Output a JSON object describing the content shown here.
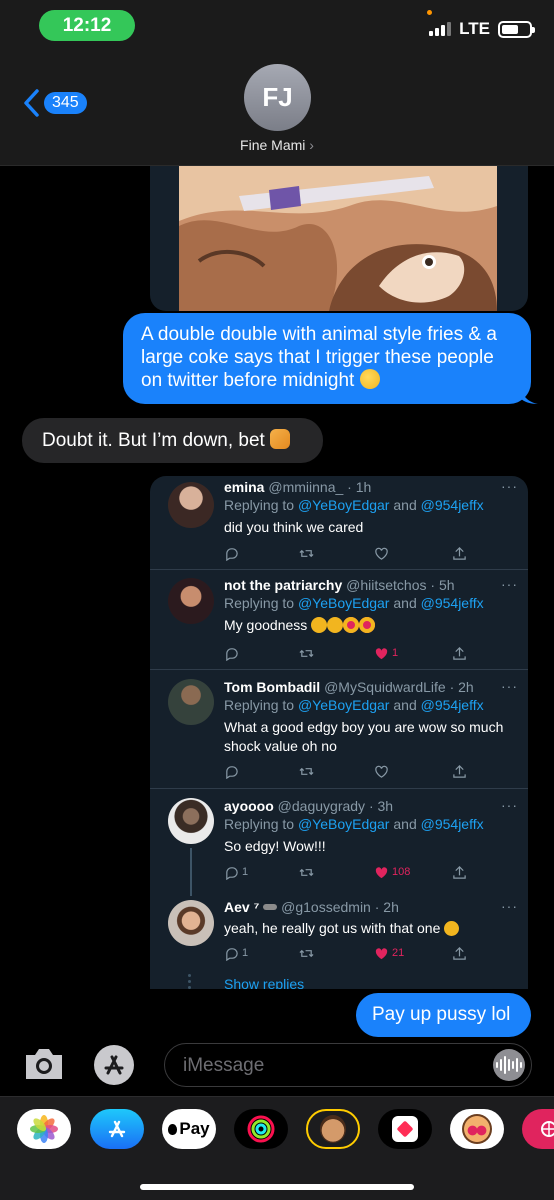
{
  "status_bar": {
    "time": "12:12",
    "network": "LTE",
    "battery_level": 0.6
  },
  "header": {
    "back_count": "345",
    "avatar_initials": "FJ",
    "contact_name": "Fine Mami",
    "chevron": "›"
  },
  "messages": {
    "out_1": "A double double with animal style fries & a large coke says that I trigger these people on twitter before midnight",
    "in_1": "Doubt it. But I’m down, bet",
    "out_2": "Pay up pussy lol"
  },
  "tweets": [
    {
      "name": "emina",
      "handle": "@mmiinna_ · 1h",
      "reply_prefix": "Replying to ",
      "mention_1": "@YeBoyEdgar",
      "reply_and": " and ",
      "mention_2": "@954jeffx",
      "text": "did you think we cared",
      "replies": "",
      "likes": "",
      "liked": false
    },
    {
      "name": "not the patriarchy",
      "handle": "@hiitsetchos · 5h",
      "reply_prefix": "Replying to ",
      "mention_1": "@YeBoyEdgar",
      "reply_and": " and ",
      "mention_2": "@954jeffx",
      "text": "My goodness",
      "replies": "",
      "likes": "1",
      "liked": true
    },
    {
      "name": "Tom Bombadil",
      "handle": "@MySquidwardLife · 2h",
      "reply_prefix": "Replying to ",
      "mention_1": "@YeBoyEdgar",
      "reply_and": " and ",
      "mention_2": "@954jeffx",
      "text": "What a good edgy boy you are wow so much shock value oh no",
      "replies": "",
      "likes": "",
      "liked": false
    },
    {
      "name": "ayoooo",
      "handle": "@daguygrady · 3h",
      "reply_prefix": "Replying to ",
      "mention_1": "@YeBoyEdgar",
      "reply_and": " and ",
      "mention_2": "@954jeffx",
      "text": "So edgy! Wow!!!",
      "replies": "1",
      "likes": "108",
      "liked": true
    },
    {
      "name": "Aev ⁷",
      "handle": "@g1ossedmin · 2h",
      "text": "yeah, he really got us with that one",
      "replies": "1",
      "likes": "21",
      "liked": true
    }
  ],
  "tweet_more": "···",
  "show_replies": "Show replies",
  "input": {
    "placeholder": "iMessage"
  },
  "app_strip": [
    "photos-icon",
    "app-store-icon",
    "apple-pay-icon",
    "activity-icon",
    "memoji-sticker-icon",
    "digital-touch-icon",
    "memoji-icon",
    "web-search-icon"
  ],
  "apple_pay_label": "Pay",
  "colors": {
    "imessage_blue": "#1a82fb",
    "twitter_bg": "#15202b",
    "twitter_link": "#1da1f2",
    "like_red": "#e0245e",
    "status_green": "#34c759"
  }
}
